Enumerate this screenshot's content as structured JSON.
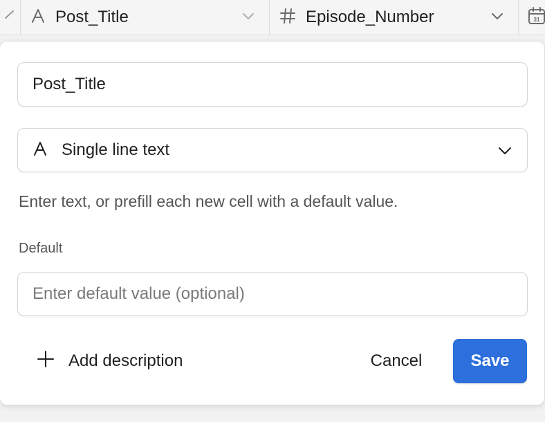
{
  "grid": {
    "columns": [
      {
        "name": "Post_Title",
        "icon": "text-type-icon"
      },
      {
        "name": "Episode_Number",
        "icon": "number-type-icon"
      },
      {
        "name": "",
        "icon": "calendar-icon",
        "calendar_day": "31"
      }
    ]
  },
  "editor": {
    "field_name": "Post_Title",
    "field_type": {
      "label": "Single line text",
      "icon": "text-type-icon"
    },
    "hint": "Enter text, or prefill each new cell with a default value.",
    "default_label": "Default",
    "default_placeholder": "Enter default value (optional)",
    "default_value": "",
    "add_description_label": "Add description",
    "cancel_label": "Cancel",
    "save_label": "Save"
  },
  "colors": {
    "accent": "#2d6fdc",
    "panel_bg": "#ffffff",
    "grid_bg": "#f5f5f5"
  }
}
